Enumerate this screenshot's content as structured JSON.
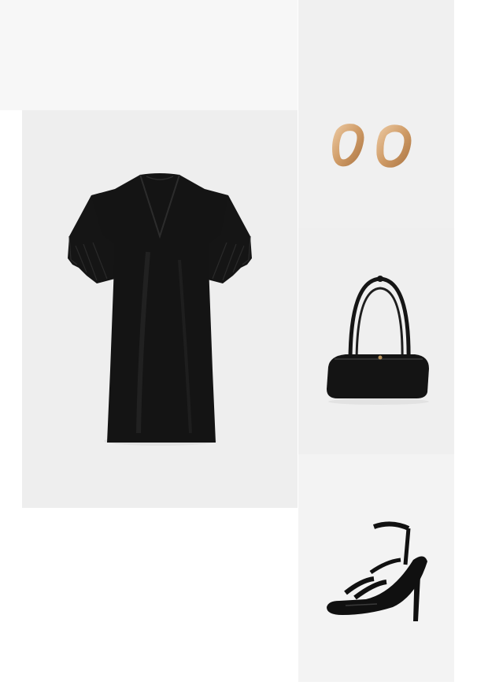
{
  "layout_label": "outfit-collage",
  "colors": {
    "page_background": "#ffffff",
    "empty_panel": "#f7f7f7",
    "dress_panel": "#eeeeee",
    "earrings_panel": "#f0f0f0",
    "handbag_panel": "#efefef",
    "sandals_panel": "#f3f3f3",
    "black_item": "#121212",
    "gold": "#d4a373"
  },
  "products": [
    {
      "id": "dress",
      "kind": "black satin mini dress with lace sleeves",
      "icon": "dress-image"
    },
    {
      "id": "earrings",
      "kind": "gold organic hoop stud earrings",
      "icon": "earrings-image"
    },
    {
      "id": "handbag",
      "kind": "black leather baguette shoulder bag",
      "icon": "handbag-image"
    },
    {
      "id": "sandals",
      "kind": "black patent strappy high-heel sandal",
      "icon": "sandal-image"
    }
  ]
}
